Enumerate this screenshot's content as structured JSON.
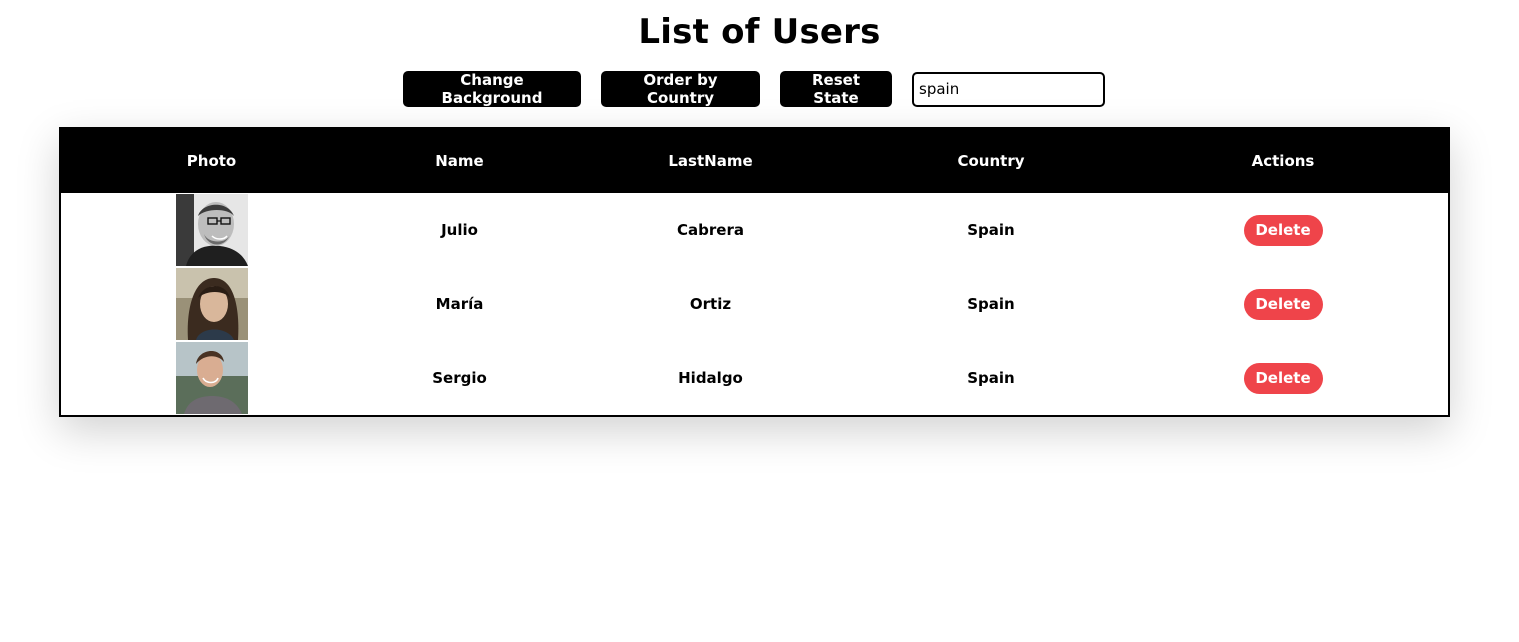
{
  "page": {
    "title": "List of Users"
  },
  "toolbar": {
    "change_background_label": "Change Background",
    "order_by_country_label": "Order by Country",
    "reset_state_label": "Reset State",
    "filter_value": "spain"
  },
  "table": {
    "headers": [
      "Photo",
      "Name",
      "LastName",
      "Country",
      "Actions"
    ],
    "rows": [
      {
        "name": "Julio",
        "last_name": "Cabrera",
        "country": "Spain",
        "action": "Delete"
      },
      {
        "name": "María",
        "last_name": "Ortiz",
        "country": "Spain",
        "action": "Delete"
      },
      {
        "name": "Sergio",
        "last_name": "Hidalgo",
        "country": "Spain",
        "action": "Delete"
      }
    ]
  },
  "colors": {
    "accent_delete": "#ef444a",
    "header_bg": "#000000",
    "button_bg": "#000000"
  }
}
